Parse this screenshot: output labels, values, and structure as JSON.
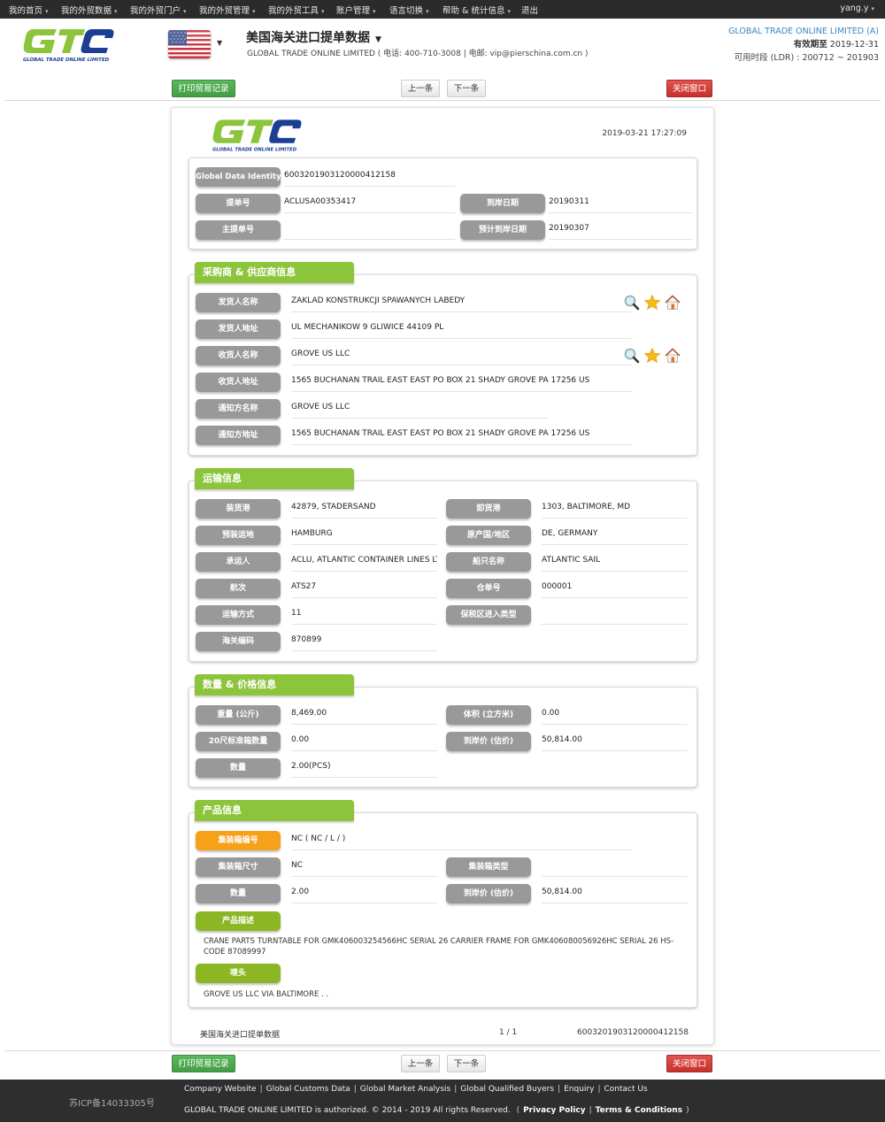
{
  "topnav": {
    "items": [
      "我的首页",
      "我的外贸数据",
      "我的外贸门户",
      "我的外贸管理",
      "我的外贸工具",
      "账户管理",
      "语言切换",
      "帮助 & 统计信息",
      "退出"
    ],
    "user": "yang.y"
  },
  "header": {
    "logo_text": "GLOBAL TRADE ONLINE LIMITED",
    "title": "美国海关进口提单数据",
    "subtitle": "GLOBAL TRADE ONLINE LIMITED ( 电话:  400-710-3008  |  电邮:  vip@pierschina.com.cn )",
    "company": "GLOBAL TRADE ONLINE LIMITED (A)",
    "expiry_label": "有效期至",
    "expiry": "2019-12-31",
    "ldr_label": "可用时段 (LDR) :",
    "ldr": "200712 ~ 201903"
  },
  "buttons": {
    "print": "打印贸易记录",
    "prev": "上一条",
    "next": "下一条",
    "close": "关闭窗口"
  },
  "doc": {
    "timestamp": "2019-03-21 17:27:09",
    "basic": {
      "gdi_label": "Global Data Identity",
      "gdi": "6003201903120000412158",
      "bill_label": "提单号",
      "bill": "ACLUSA00353417",
      "arrival_label": "到岸日期",
      "arrival": "20190311",
      "master_label": "主提单号",
      "master": "",
      "est_arrival_label": "预计到岸日期",
      "est_arrival": "20190307"
    },
    "parties": {
      "title": "采购商 & 供应商信息",
      "rows": [
        {
          "label": "发货人名称",
          "value": "ZAKLAD KONSTRUKCJI SPAWANYCH LABEDY"
        },
        {
          "label": "发货人地址",
          "value": "UL MECHANIKOW 9 GLIWICE 44109 PL"
        },
        {
          "label": "收货人名称",
          "value": "GROVE US LLC"
        },
        {
          "label": "收货人地址",
          "value": "1565 BUCHANAN TRAIL EAST EAST PO BOX 21 SHADY GROVE PA 17256 US"
        },
        {
          "label": "通知方名称",
          "value": "GROVE US LLC"
        },
        {
          "label": "通知方地址",
          "value": "1565 BUCHANAN TRAIL EAST EAST PO BOX 21 SHADY GROVE PA 17256 US"
        }
      ]
    },
    "transport": {
      "title": "运输信息",
      "left": [
        {
          "label": "装货港",
          "value": "42879, STADERSAND"
        },
        {
          "label": "预装运地",
          "value": "HAMBURG"
        },
        {
          "label": "承运人",
          "value": "ACLU, ATLANTIC CONTAINER LINES LT"
        },
        {
          "label": "航次",
          "value": "ATS27"
        },
        {
          "label": "运输方式",
          "value": "11"
        },
        {
          "label": "海关编码",
          "value": "870899"
        }
      ],
      "right": [
        {
          "label": "卸货港",
          "value": "1303, BALTIMORE, MD"
        },
        {
          "label": "原产国/地区",
          "value": "DE, GERMANY"
        },
        {
          "label": "船只名称",
          "value": "ATLANTIC SAIL"
        },
        {
          "label": "仓单号",
          "value": "000001"
        },
        {
          "label": "保税区进入类型",
          "value": ""
        }
      ]
    },
    "quantity": {
      "title": "数量 & 价格信息",
      "left": [
        {
          "label": "重量 (公斤)",
          "value": "8,469.00"
        },
        {
          "label": "20尺标准箱数量",
          "value": "0.00"
        },
        {
          "label": "数量",
          "value": "2.00(PCS)"
        }
      ],
      "right": [
        {
          "label": "体积 (立方米)",
          "value": "0.00"
        },
        {
          "label": "到岸价 (估价)",
          "value": "50,814.00"
        }
      ]
    },
    "product": {
      "title": "产品信息",
      "container_no_label": "集装箱编号",
      "container_no": "NC ( NC / L / )",
      "container_size_label": "集装箱尺寸",
      "container_size": "NC",
      "container_type_label": "集装箱类型",
      "container_type": "",
      "qty_label": "数量",
      "qty": "2.00",
      "price_label": "到岸价 (估价)",
      "price": "50,814.00",
      "desc_label": "产品描述",
      "desc": "CRANE PARTS TURNTABLE FOR GMK406003254566HC SERIAL 26 CARRIER FRAME FOR GMK406080056926HC SERIAL 26 HS-CODE 87089997",
      "marks_label": "唛头",
      "marks": "GROVE US LLC VIA BALTIMORE . ."
    },
    "footer": {
      "name": "美国海关进口提单数据",
      "page": "1 / 1",
      "id": "6003201903120000412158"
    }
  },
  "icons": [
    "search-icon",
    "star-icon",
    "home-icon"
  ],
  "footer": {
    "icp": "苏ICP备14033305号",
    "links": [
      "Company Website",
      "Global Customs Data",
      "Global Market Analysis",
      "Global Qualified Buyers",
      "Enquiry",
      "Contact Us"
    ],
    "copyright": "GLOBAL TRADE ONLINE LIMITED is authorized. © 2014 - 2019 All rights Reserved.",
    "privacy": "Privacy Policy",
    "terms": "Terms & Conditions"
  },
  "colors": {
    "brand_green": "#8cc43c",
    "brand_blue": "#1c3f94",
    "label_gray": "#999999",
    "label_orange": "#f7a11a",
    "label_olive": "#8db624",
    "print_green": "#5cb85c",
    "close_red": "#d9534f"
  }
}
